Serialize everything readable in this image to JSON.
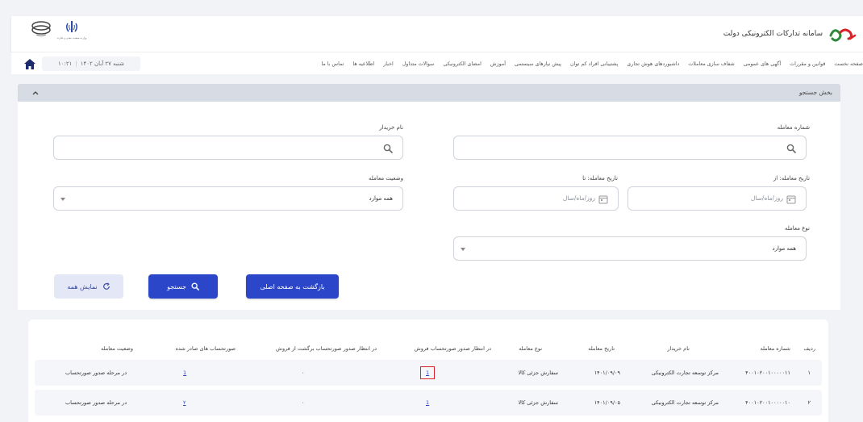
{
  "header": {
    "site_title": "سامانه تدارکات الکترونیکی دولت",
    "gov_logo_caption": "وزارت صنعت، معدن و تجارت"
  },
  "nav": {
    "items": [
      "صفحه نخست",
      "قوانین و مقررات",
      "آگهی های عمومی",
      "شفاف سازی معاملات",
      "داشبوردهای هوش تجاری",
      "پشتیبانی افراد کم توان",
      "پیش نیازهای سیستمی",
      "آموزش",
      "امضای الکترونیکی",
      "سوالات متداول",
      "اخبار",
      "اطلاعیه ها",
      "تماس با ما"
    ],
    "date_text": "شنبه ۲۷ آبان ۱۴۰۲",
    "time_text": "۱۰:۲۱"
  },
  "search": {
    "section_title": "بخش جستجو",
    "deal_number_label": "شماره معامله",
    "buyer_name_label": "نام خریدار",
    "date_from_label": "تاریخ معامله: از",
    "date_to_label": "تاریخ معامله: تا",
    "date_placeholder": "روز/ماه/سال",
    "deal_status_label": "وضعیت معامله",
    "deal_status_value": "همه موارد",
    "deal_type_label": "نوع معامله",
    "deal_type_value": "همه موارد",
    "back_button": "بازگشت به صفحه اصلی",
    "search_button": "جستجو",
    "show_all_button": "نمایش همه"
  },
  "table": {
    "columns": [
      "ردیف",
      "شماره معامله",
      "نام خریدار",
      "تاریخ معامله",
      "نوع معامله",
      "در انتظار صدور صورتحساب فروش",
      "در انتظار صدور صورتحساب برگشت از فروش",
      "صورتحساب های صادر شده",
      "وضعیت معامله"
    ],
    "rows": [
      {
        "index": "۱",
        "deal_number": "۴۰۰۱۰۲۰۰۱۰۰۰۰۰۱۱",
        "buyer": "مرکز توسعه تجارت الکترونیکی",
        "date": "۱۴۰۱/۰۹/۰۹",
        "type": "سفارش جزئی کالا",
        "pending_sale": "1",
        "pending_return": "۰",
        "issued": "1",
        "status": "در مرحله صدور صورتحساب"
      },
      {
        "index": "۲",
        "deal_number": "۴۰۰۱۰۲۰۰۱۰۰۰۰۰۱۰",
        "buyer": "مرکز توسعه تجارت الکترونیکی",
        "date": "۱۴۰۱/۰۹/۰۵",
        "type": "سفارش جزئی کالا",
        "pending_sale": "1",
        "pending_return": "۰",
        "issued": "۲",
        "status": "در مرحله صدور صورتحساب"
      }
    ]
  },
  "colors": {
    "primary": "#2b46c9",
    "highlight": "#d8232a",
    "brand_red": "#d8232a",
    "brand_green": "#2e8b3d"
  }
}
